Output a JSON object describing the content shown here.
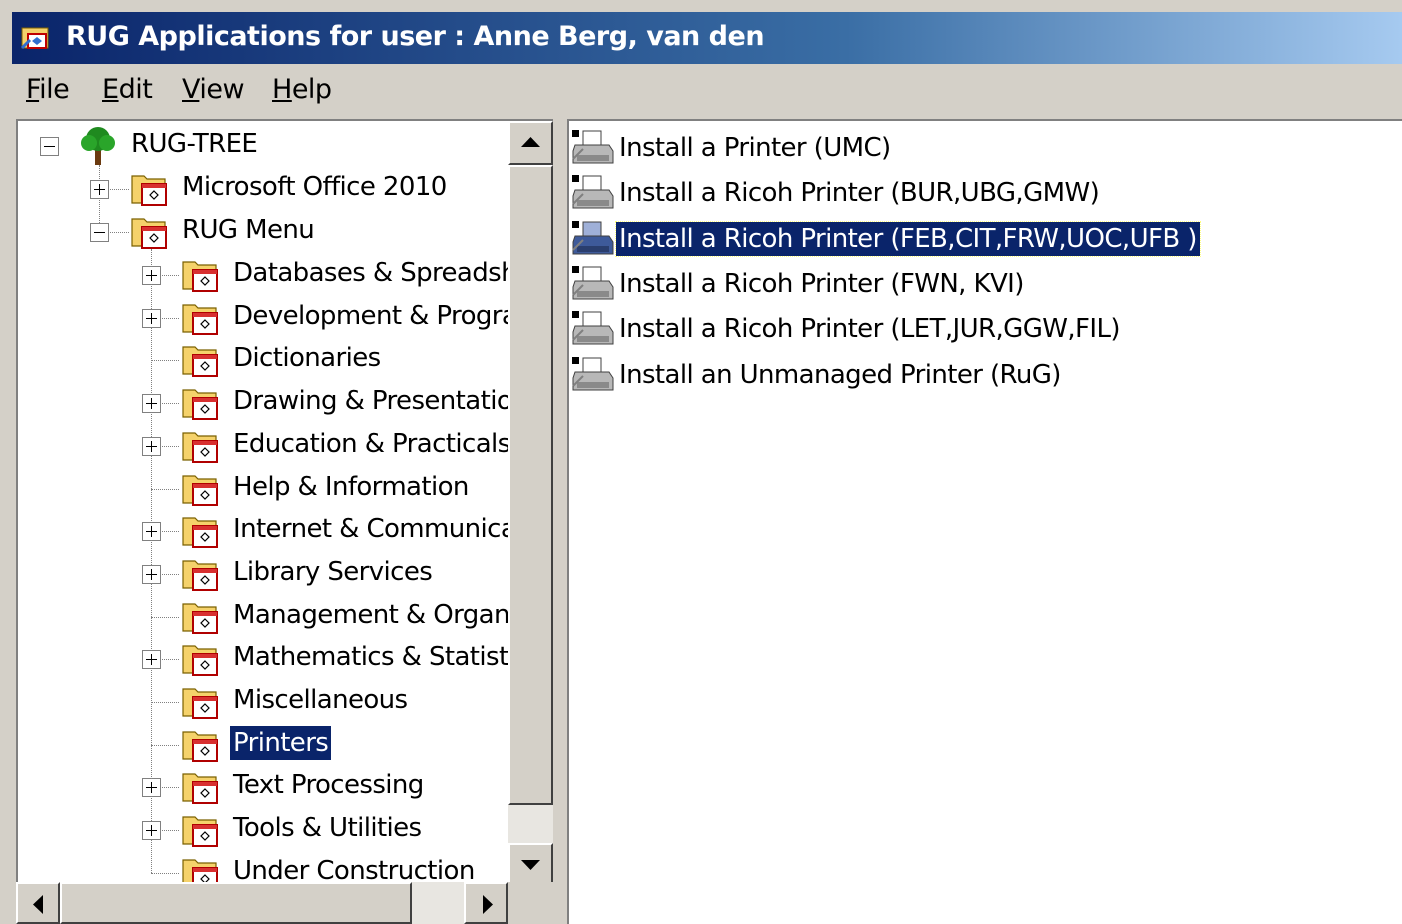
{
  "window": {
    "title": "RUG Applications for user : Anne Berg, van den"
  },
  "menu": [
    {
      "label": "File",
      "accel": "F",
      "rest": "ile"
    },
    {
      "label": "Edit",
      "accel": "E",
      "rest": "dit"
    },
    {
      "label": "View",
      "accel": "V",
      "rest": "iew"
    },
    {
      "label": "Help",
      "accel": "H",
      "rest": "elp"
    }
  ],
  "tree": {
    "root": {
      "label": "RUG-TREE",
      "icon": "tree-icon",
      "expanded": true
    },
    "level1": [
      {
        "label": "Microsoft Office 2010",
        "expander": "plus"
      },
      {
        "label": "RUG Menu",
        "expander": "minus"
      }
    ],
    "level2": [
      {
        "label": "Databases & Spreadsheets",
        "expander": "plus"
      },
      {
        "label": "Development & Programming",
        "expander": "plus"
      },
      {
        "label": "Dictionaries",
        "expander": "none"
      },
      {
        "label": "Drawing & Presentation",
        "expander": "plus"
      },
      {
        "label": "Education & Practicals",
        "expander": "plus"
      },
      {
        "label": "Help & Information",
        "expander": "none"
      },
      {
        "label": "Internet & Communication",
        "expander": "plus"
      },
      {
        "label": "Library Services",
        "expander": "plus"
      },
      {
        "label": "Management & Organisation",
        "expander": "none"
      },
      {
        "label": "Mathematics & Statistics",
        "expander": "plus"
      },
      {
        "label": "Miscellaneous",
        "expander": "none"
      },
      {
        "label": "Printers",
        "expander": "none",
        "selected": true
      },
      {
        "label": "Text Processing",
        "expander": "plus"
      },
      {
        "label": "Tools & Utilities",
        "expander": "plus"
      },
      {
        "label": "Under Construction",
        "expander": "none"
      }
    ]
  },
  "list": [
    {
      "label": "Install a Printer (UMC)",
      "selected": false
    },
    {
      "label": "Install a Ricoh Printer (BUR,UBG,GMW)",
      "selected": false
    },
    {
      "label": "Install a Ricoh Printer (FEB,CIT,FRW,UOC,UFB )",
      "selected": true
    },
    {
      "label": "Install a Ricoh Printer (FWN, KVI)",
      "selected": false
    },
    {
      "label": "Install a Ricoh Printer (LET,JUR,GGW,FIL)",
      "selected": false
    },
    {
      "label": "Install an Unmanaged Printer (RuG)",
      "selected": false
    }
  ],
  "colors": {
    "title_start": "#0a246a",
    "title_end": "#a6caf0",
    "selection": "#0a246a",
    "folder": "#f5d26b",
    "chrome": "#d4d0c8"
  }
}
